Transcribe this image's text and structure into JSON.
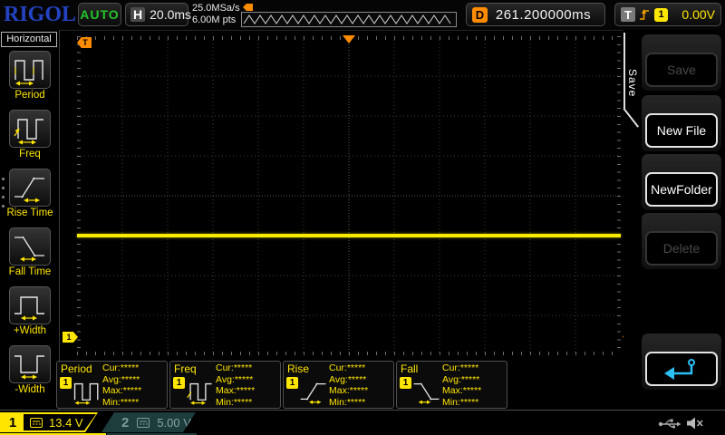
{
  "top_bar": {
    "brand": "RIGOL",
    "run_status": "AUTO",
    "horizontal": {
      "label": "H",
      "timebase": "20.0ms"
    },
    "acquisition": {
      "sample_rate": "25.0MSa/s",
      "memory_depth": "6.00M pts"
    },
    "delay": {
      "label": "D",
      "value": "261.200000ms"
    },
    "trigger": {
      "label": "T",
      "slope_icon": "rising-edge-icon",
      "source_channel": "1",
      "level": "0.00V"
    }
  },
  "left_menu": {
    "title": "Horizontal",
    "items": [
      {
        "label": "Period",
        "icon": "period-icon"
      },
      {
        "label": "Freq",
        "icon": "freq-icon"
      },
      {
        "label": "Rise Time",
        "icon": "rise-time-icon"
      },
      {
        "label": "Fall Time",
        "icon": "fall-time-icon"
      },
      {
        "label": "+Width",
        "icon": "plus-width-icon"
      },
      {
        "label": "-Width",
        "icon": "minus-width-icon"
      }
    ]
  },
  "right_menu": {
    "tab_label": "Save",
    "buttons": [
      {
        "label": "Save",
        "enabled": false
      },
      {
        "label": "New File",
        "enabled": true
      },
      {
        "label": "NewFolder",
        "enabled": true
      },
      {
        "label": "Delete",
        "enabled": false
      }
    ],
    "back_icon": "return-arrow-icon"
  },
  "graticule": {
    "divisions": {
      "horizontal": 12,
      "vertical": 8
    },
    "markers": {
      "trigger_top_left": "T",
      "trigger_position": "center-top-triangle",
      "trigger_level": "T",
      "channel1_ground": "1"
    },
    "waveform": {
      "channel": "1",
      "shape": "flat horizontal line",
      "color": "#f8ea00"
    }
  },
  "measurements": [
    {
      "title": "Period",
      "channel": "1",
      "icon": "period-icon",
      "rows": [
        "Cur:*****",
        "Avg:*****",
        "Max:*****",
        "Min:*****"
      ]
    },
    {
      "title": "Freq",
      "channel": "1",
      "icon": "freq-icon",
      "rows": [
        "Cur:*****",
        "Avg:*****",
        "Max:*****",
        "Min:*****"
      ]
    },
    {
      "title": "Rise",
      "channel": "1",
      "icon": "rise-time-icon",
      "rows": [
        "Cur:*****",
        "Avg:*****",
        "Max:*****",
        "Min:*****"
      ]
    },
    {
      "title": "Fall",
      "channel": "1",
      "icon": "fall-time-icon",
      "rows": [
        "Cur:*****",
        "Avg:*****",
        "Max:*****",
        "Min:*****"
      ]
    }
  ],
  "channel_bar": {
    "channels": [
      {
        "number": "1",
        "scale": "13.4 V",
        "coupling_icon": "dc-coupling-icon",
        "active": true
      },
      {
        "number": "2",
        "scale": "5.00 V",
        "coupling_icon": "dc-coupling-icon",
        "active": false
      }
    ],
    "status_icons": [
      "usb-icon",
      "speaker-muted-icon"
    ]
  },
  "colors": {
    "channel1": "#ffe600",
    "channel2_dim": "#7d9d9d",
    "trigger_orange": "#ff8c00",
    "run_status_green": "#23c52a",
    "brand_blue": "#2443c2",
    "back_arrow_cyan": "#2bc0f5"
  }
}
